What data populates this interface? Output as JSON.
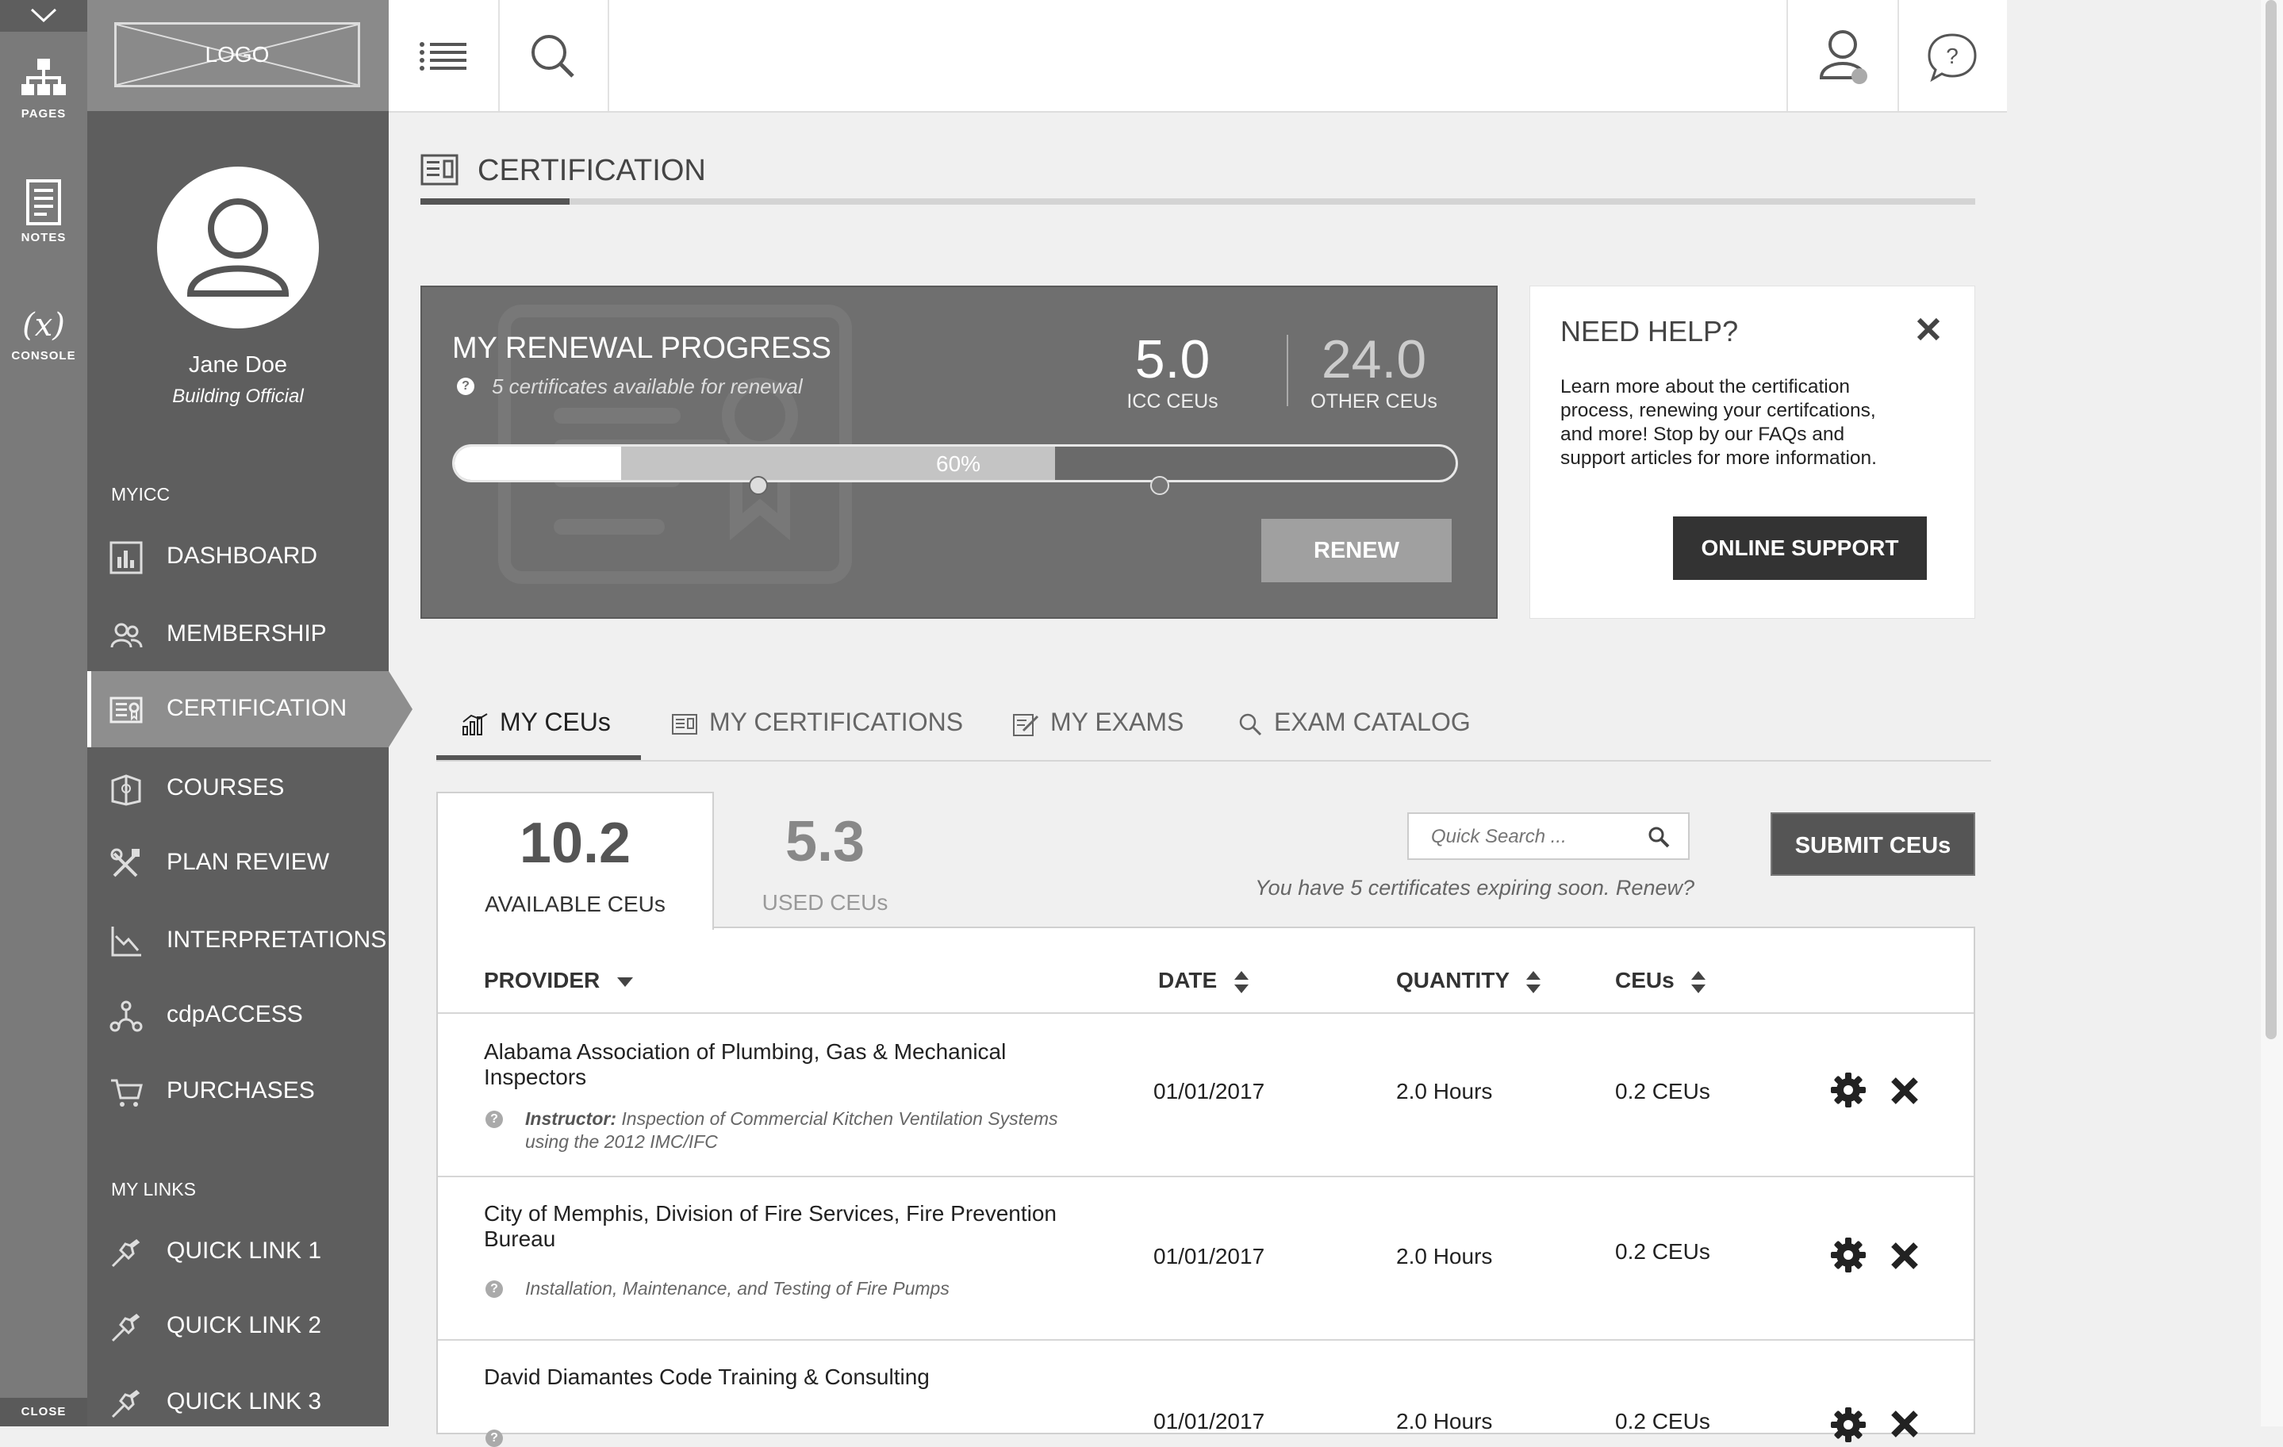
{
  "rail": {
    "pages": "PAGES",
    "notes": "NOTES",
    "console": "CONSOLE",
    "close": "CLOSE"
  },
  "logo": "LOGO",
  "user": {
    "name": "Jane Doe",
    "title": "Building Official"
  },
  "nav": {
    "section_myicc": "MYICC",
    "items": [
      {
        "label": "DASHBOARD",
        "icon": "bar-chart-icon"
      },
      {
        "label": "MEMBERSHIP",
        "icon": "people-icon"
      },
      {
        "label": "CERTIFICATION",
        "icon": "certificate-icon",
        "active": true
      },
      {
        "label": "COURSES",
        "icon": "book-icon"
      },
      {
        "label": "PLAN REVIEW",
        "icon": "tools-icon"
      },
      {
        "label": "INTERPRETATIONS",
        "icon": "chart-line-icon"
      },
      {
        "label": "cdpACCESS",
        "icon": "network-icon"
      },
      {
        "label": "PURCHASES",
        "icon": "cart-icon"
      }
    ],
    "section_links": "MY LINKS",
    "links": [
      {
        "label": "QUICK LINK 1",
        "icon": "pin-icon"
      },
      {
        "label": "QUICK LINK 2",
        "icon": "pin-icon"
      },
      {
        "label": "QUICK LINK 3",
        "icon": "pin-icon"
      }
    ]
  },
  "page": {
    "title": "CERTIFICATION"
  },
  "renewal": {
    "title": "MY RENEWAL PROGRESS",
    "subtitle": "5 certificates available for renewal",
    "icc_value": "5.0",
    "icc_label": "ICC CEUs",
    "other_value": "24.0",
    "other_label": "OTHER CEUs",
    "progress_text": "60%",
    "progress_fraction": 0.6,
    "renew_label": "RENEW"
  },
  "help": {
    "title": "NEED HELP?",
    "body": "Learn more about the certification process, renewing your certifcations, and more!  Stop by our FAQs and support articles for more information.",
    "button": "ONLINE SUPPORT"
  },
  "tabs": [
    {
      "label": "MY CEUs",
      "icon": "bar-chart-icon",
      "active": true
    },
    {
      "label": "MY CERTIFICATIONS",
      "icon": "certificate-icon"
    },
    {
      "label": "MY EXAMS",
      "icon": "edit-icon"
    },
    {
      "label": "EXAM CATALOG",
      "icon": "search-icon"
    }
  ],
  "ceu": {
    "available_value": "10.2",
    "available_label": "AVAILABLE CEUs",
    "used_value": "5.3",
    "used_label": "USED CEUs",
    "search_placeholder": "Quick Search ...",
    "expiring": "You have 5 certificates expiring soon.  Renew?",
    "submit_label": "SUBMIT CEUs"
  },
  "table": {
    "headers": {
      "provider": "PROVIDER",
      "date": "DATE",
      "quantity": "QUANTITY",
      "ceus": "CEUs"
    },
    "rows": [
      {
        "provider_line1": "Alabama Association of Plumbing, Gas & Mechanical",
        "provider_line2": "Inspectors",
        "desc_prefix": "Instructor:",
        "desc_line1": " Inspection of Commercial Kitchen Ventilation Systems",
        "desc_line2": "using the 2012 IMC/IFC",
        "date": "01/01/2017",
        "quantity": "2.0 Hours",
        "ceus": "0.2 CEUs"
      },
      {
        "provider_line1": "City of Memphis, Division of Fire Services, Fire Prevention",
        "provider_line2": "Bureau",
        "desc_prefix": "",
        "desc_line1": "Installation, Maintenance, and Testing of Fire Pumps",
        "desc_line2": "",
        "date": "01/01/2017",
        "quantity": "2.0 Hours",
        "ceus": "0.2 CEUs"
      },
      {
        "provider_line1": "David Diamantes Code Training & Consulting",
        "provider_line2": "",
        "desc_prefix": "",
        "desc_line1": "",
        "desc_line2": "",
        "date": "01/01/2017",
        "quantity": "2.0 Hours",
        "ceus": "0.2 CEUs"
      }
    ]
  }
}
